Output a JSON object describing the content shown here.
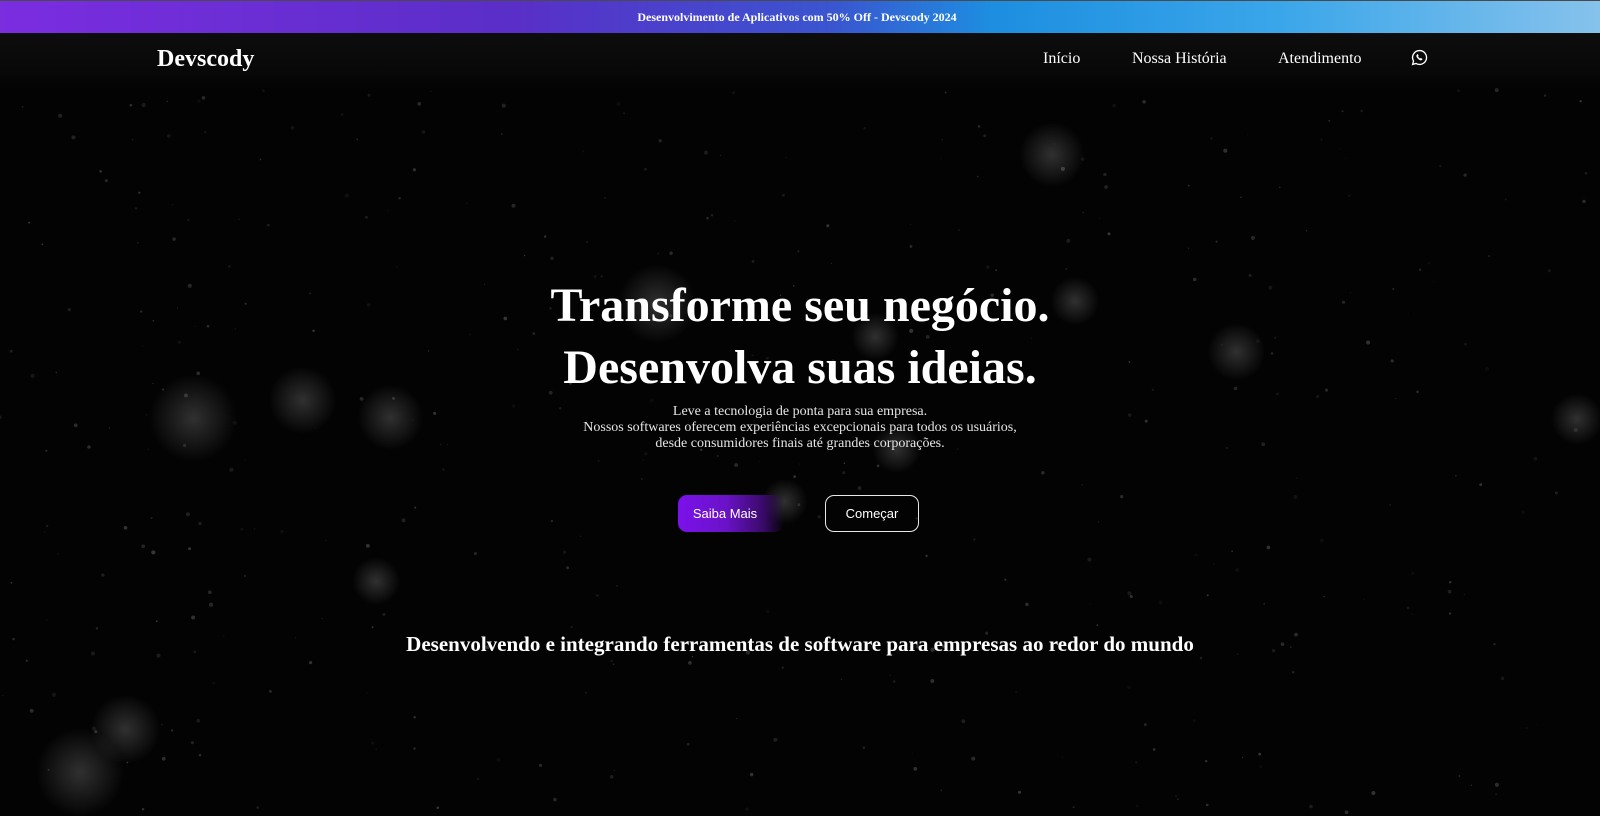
{
  "promo": {
    "text": "Desenvolvimento de Aplicativos com 50% Off - Devscody 2024"
  },
  "navbar": {
    "brand": "Devscody",
    "links": [
      "Início",
      "Nossa História",
      "Atendimento"
    ],
    "whatsapp_icon": "whatsapp-icon"
  },
  "hero": {
    "title_line1": "Transforme seu negócio.",
    "title_line2": "Desenvolva suas ideias.",
    "subtitle_lines": [
      "Leve a tecnologia de ponta para sua empresa.",
      "Nossos softwares oferecem experiências excepcionais para todos os usuários,",
      "desde consumidores finais até grandes corporações."
    ],
    "primary_button": "Saiba Mais",
    "secondary_button": "Começar"
  },
  "tagline": "Desenvolvendo e integrando ferramentas de software para empresas ao redor do mundo",
  "colors": {
    "background": "#030303",
    "accent_purple": "#7b12ea",
    "promo_gradient_start": "#7b2de0",
    "promo_gradient_end": "#86c2ec"
  }
}
